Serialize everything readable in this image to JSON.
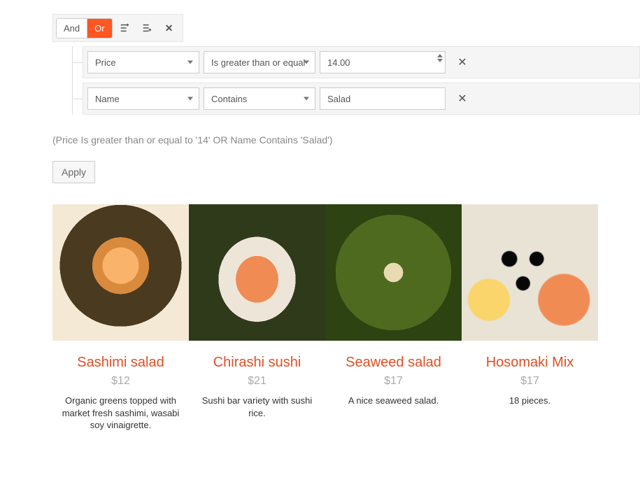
{
  "filter": {
    "and_label": "And",
    "or_label": "Or",
    "active_logic": "Or",
    "rules": [
      {
        "field": "Price",
        "operator": "Is greater than or equal",
        "value": "14.00",
        "numeric": true
      },
      {
        "field": "Name",
        "operator": "Contains",
        "value": "Salad",
        "numeric": false
      }
    ],
    "expression_text": "(Price Is greater than or equal to '14' OR Name Contains 'Salad')"
  },
  "buttons": {
    "apply_label": "Apply"
  },
  "items": [
    {
      "name": "Sashimi salad",
      "price": "$12",
      "desc": "Organic greens topped with market fresh sashimi, wasabi soy vinaigrette."
    },
    {
      "name": "Chirashi sushi",
      "price": "$21",
      "desc": "Sushi bar variety with sushi rice."
    },
    {
      "name": "Seaweed salad",
      "price": "$17",
      "desc": "A nice seaweed salad."
    },
    {
      "name": "Hosomaki Mix",
      "price": "$17",
      "desc": "18 pieces."
    }
  ]
}
